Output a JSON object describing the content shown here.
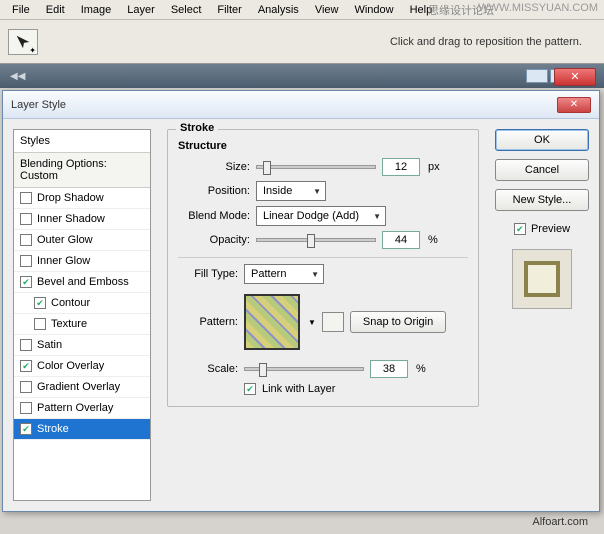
{
  "watermark": {
    "cn": "思缘设计论坛",
    "url": "WWW.MISSYUAN.COM"
  },
  "menubar": [
    "File",
    "Edit",
    "Image",
    "Layer",
    "Select",
    "Filter",
    "Analysis",
    "View",
    "Window",
    "Help"
  ],
  "toolbar": {
    "hint": "Click and drag to reposition the pattern."
  },
  "dialog": {
    "title": "Layer Style",
    "styles": {
      "header": "Styles",
      "blending": "Blending Options: Custom",
      "items": [
        {
          "label": "Drop Shadow",
          "checked": false
        },
        {
          "label": "Inner Shadow",
          "checked": false
        },
        {
          "label": "Outer Glow",
          "checked": false
        },
        {
          "label": "Inner Glow",
          "checked": false
        },
        {
          "label": "Bevel and Emboss",
          "checked": true
        },
        {
          "label": "Contour",
          "checked": true,
          "indent": true
        },
        {
          "label": "Texture",
          "checked": false,
          "indent": true
        },
        {
          "label": "Satin",
          "checked": false
        },
        {
          "label": "Color Overlay",
          "checked": true
        },
        {
          "label": "Gradient Overlay",
          "checked": false
        },
        {
          "label": "Pattern Overlay",
          "checked": false
        },
        {
          "label": "Stroke",
          "checked": true,
          "selected": true
        }
      ]
    },
    "stroke": {
      "group": "Stroke",
      "structure": "Structure",
      "size_label": "Size:",
      "size_value": "12",
      "size_unit": "px",
      "position_label": "Position:",
      "position_value": "Inside",
      "blendmode_label": "Blend Mode:",
      "blendmode_value": "Linear Dodge (Add)",
      "opacity_label": "Opacity:",
      "opacity_value": "44",
      "opacity_unit": "%",
      "filltype_label": "Fill Type:",
      "filltype_value": "Pattern",
      "pattern_label": "Pattern:",
      "snap": "Snap to Origin",
      "scale_label": "Scale:",
      "scale_value": "38",
      "scale_unit": "%",
      "link_label": "Link with Layer",
      "link_checked": true
    },
    "buttons": {
      "ok": "OK",
      "cancel": "Cancel",
      "newstyle": "New Style...",
      "preview": "Preview"
    }
  },
  "credit": "Alfoart.com"
}
